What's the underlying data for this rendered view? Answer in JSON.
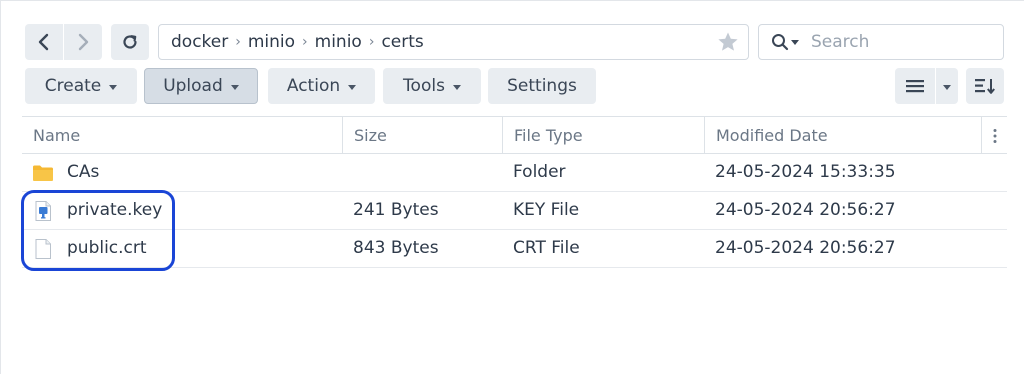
{
  "breadcrumb": [
    "docker",
    "minio",
    "minio",
    "certs"
  ],
  "search": {
    "placeholder": "Search"
  },
  "toolbar": {
    "create_label": "Create",
    "upload_label": "Upload",
    "action_label": "Action",
    "tools_label": "Tools",
    "settings_label": "Settings"
  },
  "table": {
    "columns": [
      "Name",
      "Size",
      "File Type",
      "Modified Date"
    ],
    "rows": [
      {
        "name": "CAs",
        "size": "",
        "type": "Folder",
        "modified": "24-05-2024 15:33:35",
        "icon": "folder-icon"
      },
      {
        "name": "private.key",
        "size": "241 Bytes",
        "type": "KEY File",
        "modified": "24-05-2024 20:56:27",
        "icon": "key-file-icon"
      },
      {
        "name": "public.crt",
        "size": "843 Bytes",
        "type": "CRT File",
        "modified": "24-05-2024 20:56:27",
        "icon": "file-icon"
      }
    ]
  },
  "colors": {
    "highlight": "#1a45d6",
    "folder": "#f5b833",
    "toolbar_button": "#e9edf1"
  }
}
